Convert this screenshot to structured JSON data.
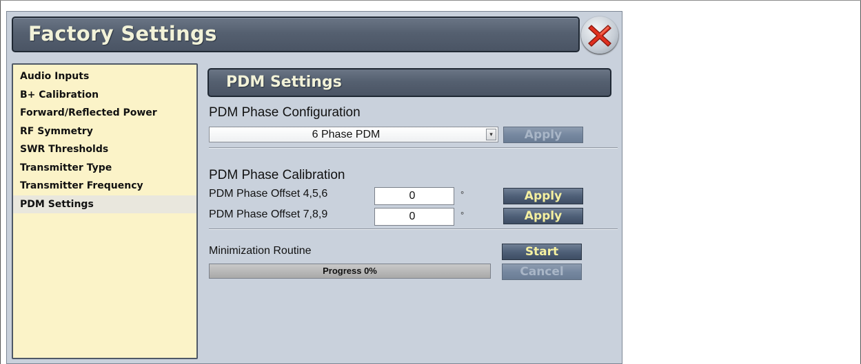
{
  "window": {
    "title": "Factory Settings"
  },
  "sidebar": {
    "items": [
      {
        "label": "Audio Inputs"
      },
      {
        "label": "B+ Calibration"
      },
      {
        "label": "Forward/Reflected Power"
      },
      {
        "label": "RF Symmetry"
      },
      {
        "label": "SWR Thresholds"
      },
      {
        "label": "Transmitter Type"
      },
      {
        "label": "Transmitter Frequency"
      },
      {
        "label": "PDM Settings",
        "active": true
      }
    ]
  },
  "panel": {
    "title": "PDM Settings",
    "phase_config": {
      "heading": "PDM Phase Configuration",
      "selected": "6 Phase PDM",
      "apply_label": "Apply"
    },
    "phase_calibration": {
      "heading": "PDM Phase Calibration",
      "rows": [
        {
          "label": "PDM Phase Offset 4,5,6",
          "value": "0",
          "unit": "°",
          "apply_label": "Apply"
        },
        {
          "label": "PDM Phase Offset 7,8,9",
          "value": "0",
          "unit": "°",
          "apply_label": "Apply"
        }
      ]
    },
    "minimization": {
      "label": "Minimization Routine",
      "start_label": "Start",
      "progress_text": "Progress 0%",
      "progress_percent": 0,
      "cancel_label": "Cancel"
    }
  },
  "icons": {
    "close": "close-icon"
  },
  "colors": {
    "title_bar": "#556070",
    "title_text": "#f2f2d8",
    "sidebar_bg": "#fbf3c8",
    "window_bg": "#c9d1dc",
    "button_text": "#f5f0a0",
    "close_x": "#e03020"
  }
}
